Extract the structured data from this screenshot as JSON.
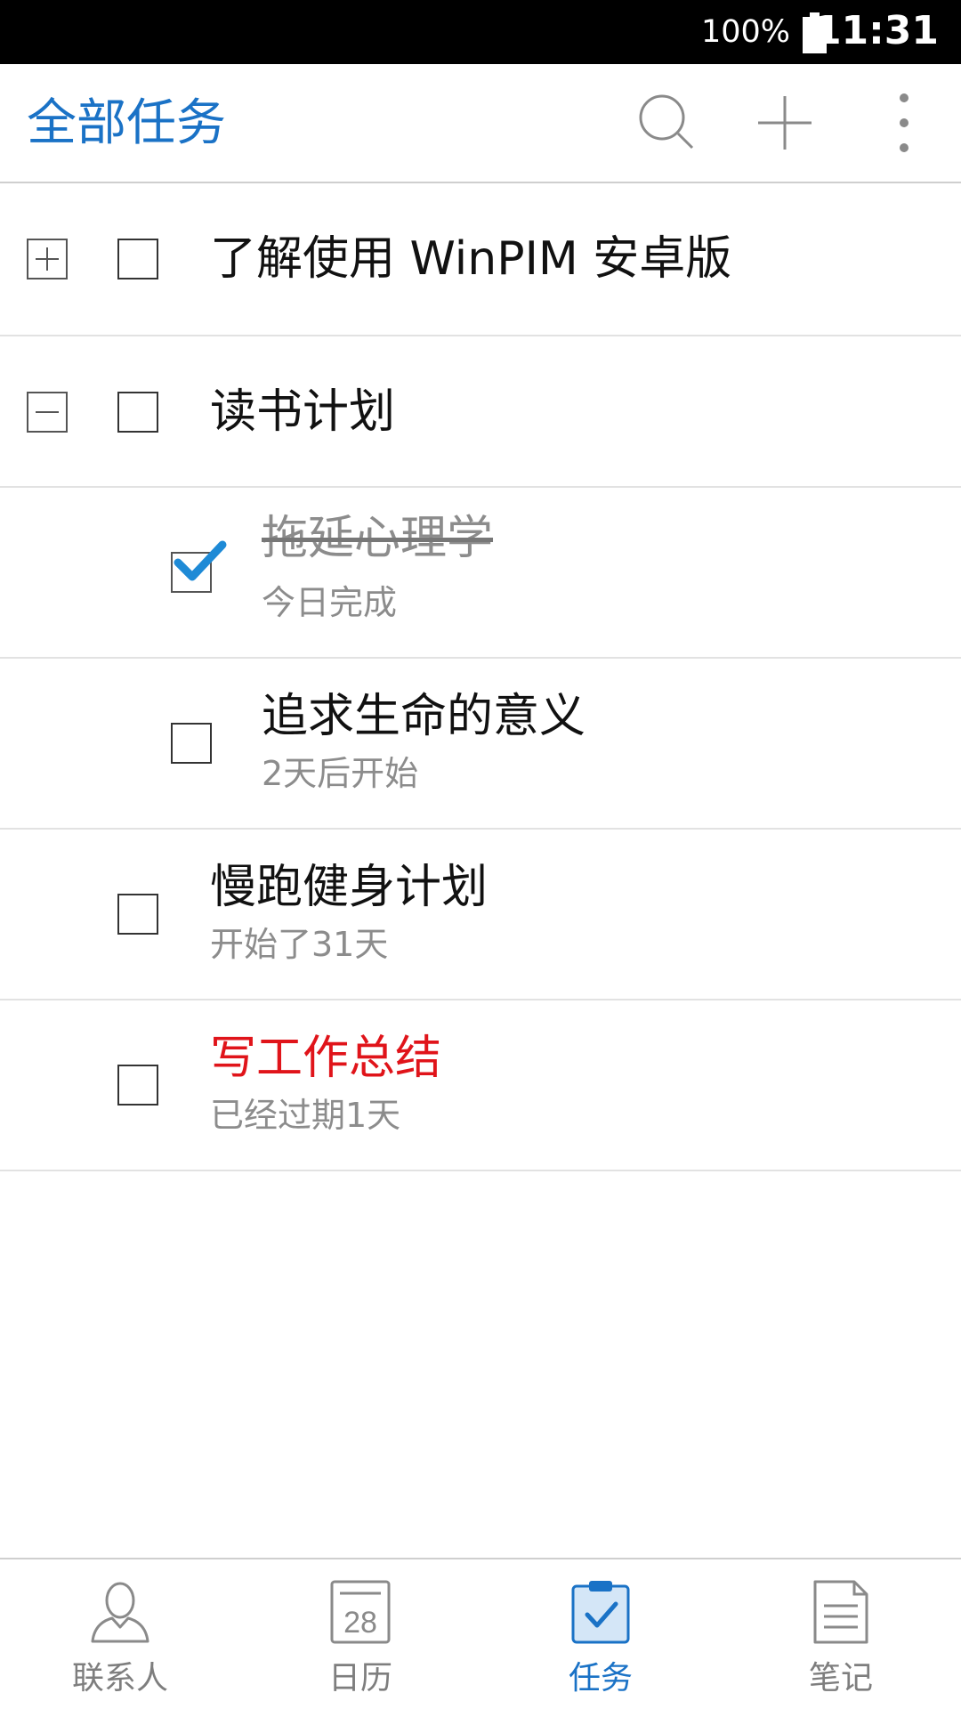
{
  "status_bar": {
    "battery": "100%",
    "time": "11:31"
  },
  "app_bar": {
    "title": "全部任务",
    "icons": [
      "search-icon",
      "add-icon",
      "more-vert-icon"
    ]
  },
  "tasks": [
    {
      "title": "了解使用 WinPIM 安卓版",
      "subtitle": "",
      "checked": false,
      "expander": "plus"
    },
    {
      "title": "读书计划",
      "subtitle": "",
      "checked": false,
      "expander": "minus"
    },
    {
      "title": "拖延心理学",
      "subtitle": "今日完成",
      "checked": true,
      "state": "completed"
    },
    {
      "title": "追求生命的意义",
      "subtitle": "2天后开始",
      "checked": false
    },
    {
      "title": "慢跑健身计划",
      "subtitle": "开始了31天",
      "checked": false
    },
    {
      "title": "写工作总结",
      "subtitle": "已经过期1天",
      "checked": false,
      "state": "overdue"
    }
  ],
  "bottom_nav": {
    "items": [
      {
        "label": "联系人",
        "icon": "contacts-icon",
        "active": false
      },
      {
        "label": "日历",
        "icon": "calendar-icon",
        "calendar_day": "28",
        "active": false
      },
      {
        "label": "任务",
        "icon": "tasks-icon",
        "active": true
      },
      {
        "label": "笔记",
        "icon": "notes-icon",
        "active": false
      }
    ]
  },
  "colors": {
    "accent": "#1a72c6",
    "overdue": "#e0141a",
    "secondary_text": "#8c8c8c",
    "check": "#1e8ad6"
  }
}
